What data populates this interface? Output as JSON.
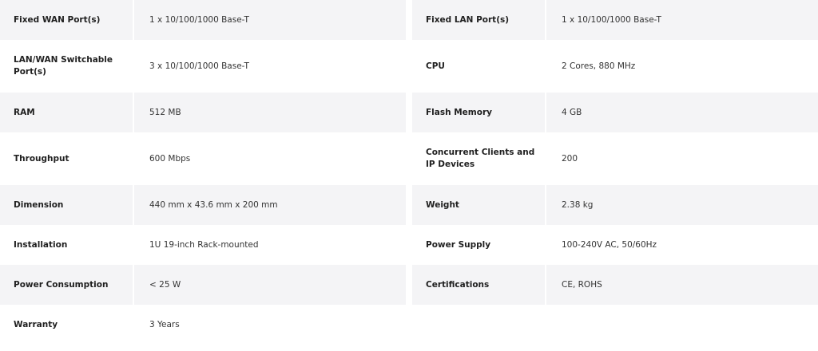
{
  "left": [
    {
      "label": "Fixed WAN Port(s)",
      "value": "1 x 10/100/1000 Base-T"
    },
    {
      "label": "LAN/WAN Switchable Port(s)",
      "value": "3 x 10/100/1000 Base-T"
    },
    {
      "label": "RAM",
      "value": "512 MB"
    },
    {
      "label": "Throughput",
      "value": "600 Mbps"
    },
    {
      "label": "Dimension",
      "value": "440 mm x 43.6 mm x 200 mm"
    },
    {
      "label": "Installation",
      "value": "1U 19-inch Rack-mounted"
    },
    {
      "label": "Power Consumption",
      "value": "< 25 W"
    },
    {
      "label": "Warranty",
      "value": "3 Years"
    }
  ],
  "right": [
    {
      "label": "Fixed LAN Port(s)",
      "value": "1 x 10/100/1000 Base-T"
    },
    {
      "label": "CPU",
      "value": "2 Cores, 880 MHz"
    },
    {
      "label": "Flash Memory",
      "value": "4 GB"
    },
    {
      "label": "Concurrent Clients and IP Devices",
      "value": "200"
    },
    {
      "label": "Weight",
      "value": "2.38 kg"
    },
    {
      "label": "Power Supply",
      "value": "100-240V AC, 50/60Hz"
    },
    {
      "label": "Certifications",
      "value": "CE, ROHS"
    }
  ]
}
